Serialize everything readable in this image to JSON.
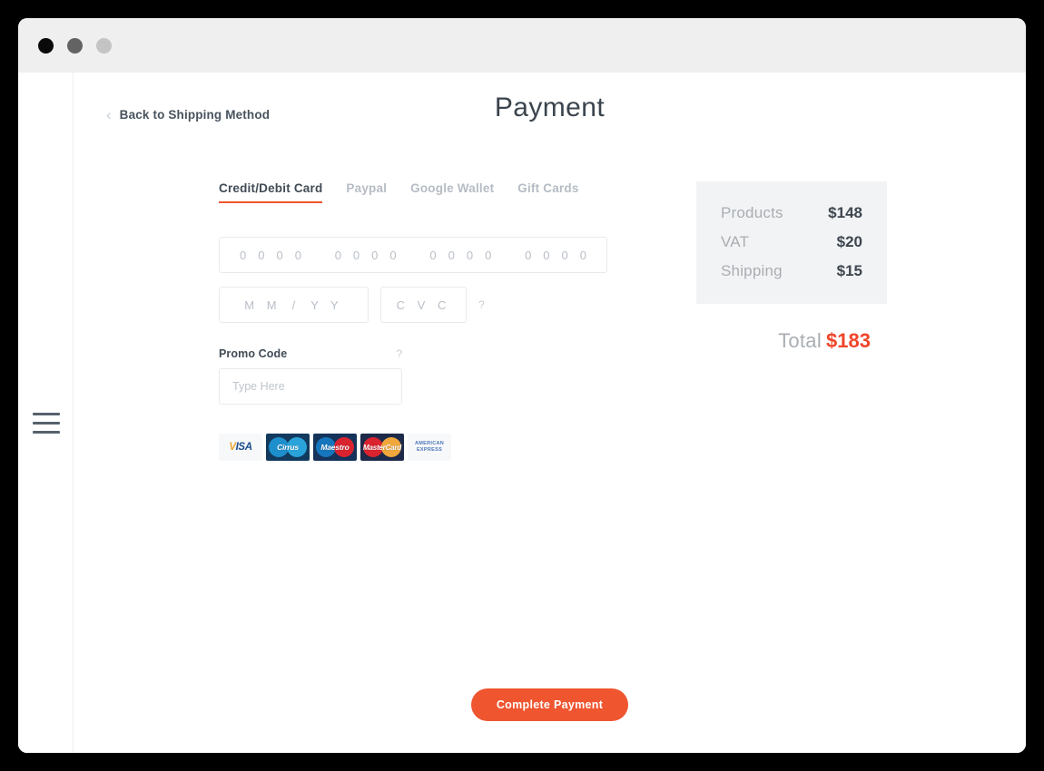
{
  "window": {
    "controls": [
      {
        "name": "close",
        "color": "#0a0a0a"
      },
      {
        "name": "minimize",
        "color": "#636363"
      },
      {
        "name": "maximize",
        "color": "#c4c4c4"
      }
    ]
  },
  "sidebar": {
    "menu_icon": "hamburger-icon"
  },
  "header": {
    "back_chevron": "‹",
    "back_label": "Back to Shipping Method",
    "title": "Payment"
  },
  "tabs": [
    {
      "label": "Credit/Debit Card",
      "active": true
    },
    {
      "label": "Paypal",
      "active": false
    },
    {
      "label": "Google Wallet",
      "active": false
    },
    {
      "label": "Gift Cards",
      "active": false
    }
  ],
  "form": {
    "card_number": {
      "groups": [
        [
          "0",
          "0",
          "0",
          "0"
        ],
        [
          "0",
          "0",
          "0",
          "0"
        ],
        [
          "0",
          "0",
          "0",
          "0"
        ],
        [
          "0",
          "0",
          "0",
          "0"
        ]
      ]
    },
    "expiry": {
      "month": "M M",
      "separator": "/",
      "year": "Y Y"
    },
    "cvc": {
      "placeholder": "C V C",
      "help": "?"
    },
    "promo": {
      "label": "Promo Code",
      "help": "?",
      "placeholder": "Type Here",
      "value": ""
    }
  },
  "card_logos": [
    {
      "name": "visa",
      "text": "VISA",
      "accent": "#e8a433",
      "bg": "#f7f8f9"
    },
    {
      "name": "cirrus",
      "text": "Cirrus",
      "bg": "#123a5e"
    },
    {
      "name": "maestro",
      "text": "Maestro",
      "bg": "#14325a"
    },
    {
      "name": "mastercard",
      "text": "MasterCard",
      "bg": "#1d2a4a"
    },
    {
      "name": "amex",
      "line1": "AMERICAN",
      "line2": "EXPRESS",
      "bg": "#f7f8f9"
    }
  ],
  "summary": {
    "rows": [
      {
        "label": "Products",
        "value": "$148"
      },
      {
        "label": "VAT",
        "value": "$20"
      },
      {
        "label": "Shipping",
        "value": "$15"
      }
    ],
    "total_label": "Total",
    "total_value": "$183"
  },
  "cta": {
    "label": "Complete Payment"
  },
  "colors": {
    "accent": "#ef5630",
    "total_accent": "#f0452a",
    "muted": "#b6bcc4",
    "text": "#414b55",
    "panel_bg": "#f2f3f4"
  }
}
